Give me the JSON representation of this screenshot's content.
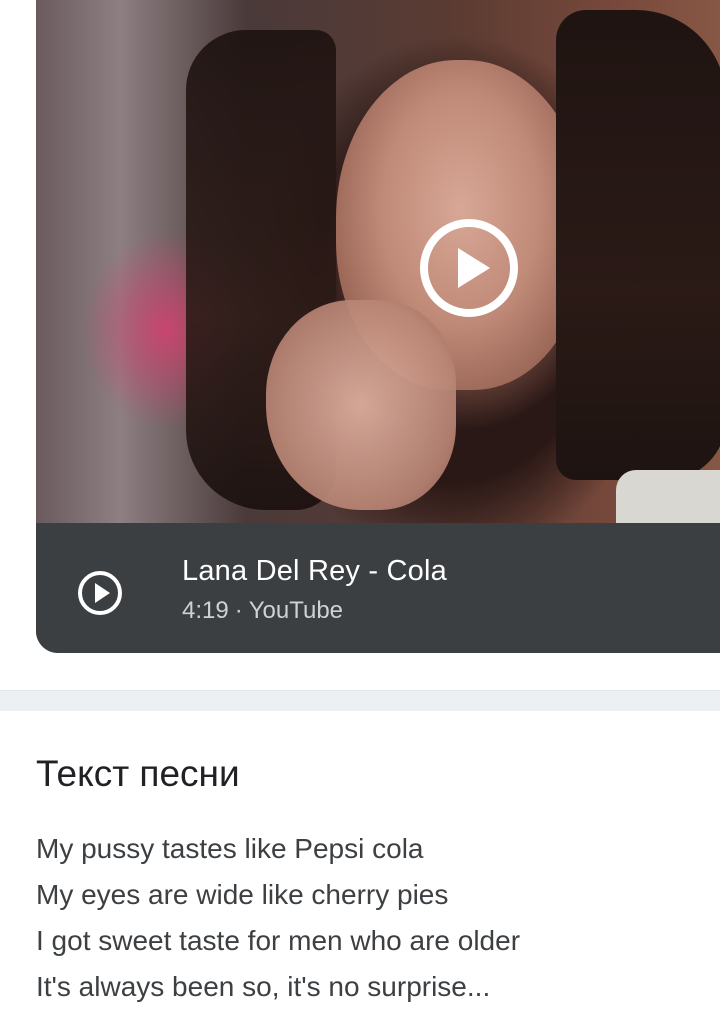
{
  "video": {
    "title": "Lana Del Rey - Cola",
    "duration": "4:19",
    "separator": "·",
    "source": "YouTube",
    "thumbnail_icon": "play-circle-icon",
    "info_icon": "play-circle-icon"
  },
  "lyrics_section": {
    "heading": "Текст песни",
    "lines": [
      "My pussy tastes like Pepsi cola",
      "My eyes are wide like cherry pies",
      "I got sweet taste for men who are older",
      "It's always been so, it's no surprise..."
    ]
  },
  "colors": {
    "info_bar_bg": "#3c3f42",
    "title_text": "#ffffff",
    "meta_text": "#cfd2d5",
    "heading_text": "#202124",
    "lyrics_text": "#3c4043",
    "divider": "#edf0f3"
  }
}
